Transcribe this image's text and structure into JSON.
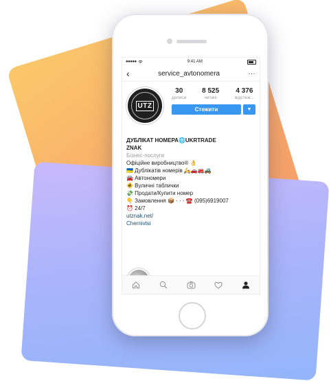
{
  "status_bar": {
    "time": "9:41 AM"
  },
  "nav": {
    "back_glyph": "‹",
    "username": "service_avtonomera",
    "more_glyph": "···"
  },
  "profile": {
    "avatar_text": "UTZ",
    "stats": [
      {
        "value": "30",
        "label": "дописи"
      },
      {
        "value": "8 525",
        "label": "читачі"
      },
      {
        "value": "4 376",
        "label": "відстеж..."
      }
    ],
    "follow_label": "Стежити",
    "dropdown_glyph": "▼"
  },
  "bio": {
    "name_line1": "ДУБЛІКАТ НОМЕРА🌐UKRTRADE",
    "name_line2": "ZNAK",
    "category": "Бізнес-послуги",
    "lines": [
      "Офіційне виробництво® 👌",
      "🇺🇦 Дублікатів номерів 🛵🚗🚒🚜",
      "🚘 Автономери",
      "🚸 Вуличні таблички",
      "💸 Продати/Купити номер",
      "👇 Замовлення 📦 · · · ☎️ (095)6919007",
      "⏰ 24/7"
    ],
    "link": "utznak.net/",
    "location": "Chernivtsi"
  },
  "tabs": [
    {
      "icon": "home-icon"
    },
    {
      "icon": "search-icon"
    },
    {
      "icon": "camera-icon"
    },
    {
      "icon": "heart-icon"
    },
    {
      "icon": "profile-icon"
    }
  ],
  "colors": {
    "accent": "#3897f0",
    "card_orange": "#f7a56a",
    "card_purple": "#a9b4fb"
  }
}
